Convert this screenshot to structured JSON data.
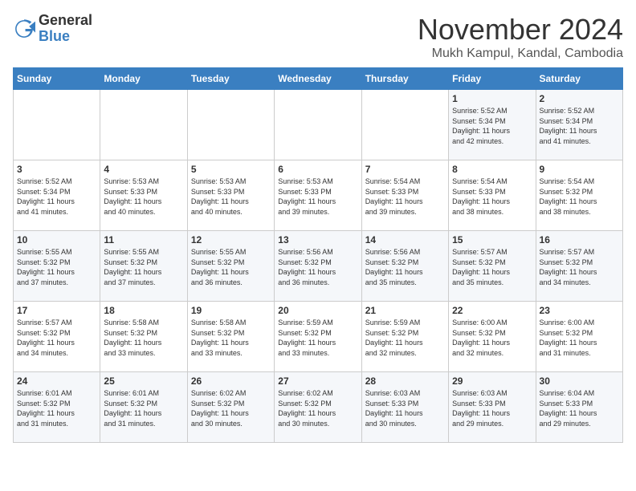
{
  "header": {
    "logo_general": "General",
    "logo_blue": "Blue",
    "month_title": "November 2024",
    "location": "Mukh Kampul, Kandal, Cambodia"
  },
  "weekdays": [
    "Sunday",
    "Monday",
    "Tuesday",
    "Wednesday",
    "Thursday",
    "Friday",
    "Saturday"
  ],
  "weeks": [
    [
      {
        "day": "",
        "info": ""
      },
      {
        "day": "",
        "info": ""
      },
      {
        "day": "",
        "info": ""
      },
      {
        "day": "",
        "info": ""
      },
      {
        "day": "",
        "info": ""
      },
      {
        "day": "1",
        "info": "Sunrise: 5:52 AM\nSunset: 5:34 PM\nDaylight: 11 hours\nand 42 minutes."
      },
      {
        "day": "2",
        "info": "Sunrise: 5:52 AM\nSunset: 5:34 PM\nDaylight: 11 hours\nand 41 minutes."
      }
    ],
    [
      {
        "day": "3",
        "info": "Sunrise: 5:52 AM\nSunset: 5:34 PM\nDaylight: 11 hours\nand 41 minutes."
      },
      {
        "day": "4",
        "info": "Sunrise: 5:53 AM\nSunset: 5:33 PM\nDaylight: 11 hours\nand 40 minutes."
      },
      {
        "day": "5",
        "info": "Sunrise: 5:53 AM\nSunset: 5:33 PM\nDaylight: 11 hours\nand 40 minutes."
      },
      {
        "day": "6",
        "info": "Sunrise: 5:53 AM\nSunset: 5:33 PM\nDaylight: 11 hours\nand 39 minutes."
      },
      {
        "day": "7",
        "info": "Sunrise: 5:54 AM\nSunset: 5:33 PM\nDaylight: 11 hours\nand 39 minutes."
      },
      {
        "day": "8",
        "info": "Sunrise: 5:54 AM\nSunset: 5:33 PM\nDaylight: 11 hours\nand 38 minutes."
      },
      {
        "day": "9",
        "info": "Sunrise: 5:54 AM\nSunset: 5:32 PM\nDaylight: 11 hours\nand 38 minutes."
      }
    ],
    [
      {
        "day": "10",
        "info": "Sunrise: 5:55 AM\nSunset: 5:32 PM\nDaylight: 11 hours\nand 37 minutes."
      },
      {
        "day": "11",
        "info": "Sunrise: 5:55 AM\nSunset: 5:32 PM\nDaylight: 11 hours\nand 37 minutes."
      },
      {
        "day": "12",
        "info": "Sunrise: 5:55 AM\nSunset: 5:32 PM\nDaylight: 11 hours\nand 36 minutes."
      },
      {
        "day": "13",
        "info": "Sunrise: 5:56 AM\nSunset: 5:32 PM\nDaylight: 11 hours\nand 36 minutes."
      },
      {
        "day": "14",
        "info": "Sunrise: 5:56 AM\nSunset: 5:32 PM\nDaylight: 11 hours\nand 35 minutes."
      },
      {
        "day": "15",
        "info": "Sunrise: 5:57 AM\nSunset: 5:32 PM\nDaylight: 11 hours\nand 35 minutes."
      },
      {
        "day": "16",
        "info": "Sunrise: 5:57 AM\nSunset: 5:32 PM\nDaylight: 11 hours\nand 34 minutes."
      }
    ],
    [
      {
        "day": "17",
        "info": "Sunrise: 5:57 AM\nSunset: 5:32 PM\nDaylight: 11 hours\nand 34 minutes."
      },
      {
        "day": "18",
        "info": "Sunrise: 5:58 AM\nSunset: 5:32 PM\nDaylight: 11 hours\nand 33 minutes."
      },
      {
        "day": "19",
        "info": "Sunrise: 5:58 AM\nSunset: 5:32 PM\nDaylight: 11 hours\nand 33 minutes."
      },
      {
        "day": "20",
        "info": "Sunrise: 5:59 AM\nSunset: 5:32 PM\nDaylight: 11 hours\nand 33 minutes."
      },
      {
        "day": "21",
        "info": "Sunrise: 5:59 AM\nSunset: 5:32 PM\nDaylight: 11 hours\nand 32 minutes."
      },
      {
        "day": "22",
        "info": "Sunrise: 6:00 AM\nSunset: 5:32 PM\nDaylight: 11 hours\nand 32 minutes."
      },
      {
        "day": "23",
        "info": "Sunrise: 6:00 AM\nSunset: 5:32 PM\nDaylight: 11 hours\nand 31 minutes."
      }
    ],
    [
      {
        "day": "24",
        "info": "Sunrise: 6:01 AM\nSunset: 5:32 PM\nDaylight: 11 hours\nand 31 minutes."
      },
      {
        "day": "25",
        "info": "Sunrise: 6:01 AM\nSunset: 5:32 PM\nDaylight: 11 hours\nand 31 minutes."
      },
      {
        "day": "26",
        "info": "Sunrise: 6:02 AM\nSunset: 5:32 PM\nDaylight: 11 hours\nand 30 minutes."
      },
      {
        "day": "27",
        "info": "Sunrise: 6:02 AM\nSunset: 5:32 PM\nDaylight: 11 hours\nand 30 minutes."
      },
      {
        "day": "28",
        "info": "Sunrise: 6:03 AM\nSunset: 5:33 PM\nDaylight: 11 hours\nand 30 minutes."
      },
      {
        "day": "29",
        "info": "Sunrise: 6:03 AM\nSunset: 5:33 PM\nDaylight: 11 hours\nand 29 minutes."
      },
      {
        "day": "30",
        "info": "Sunrise: 6:04 AM\nSunset: 5:33 PM\nDaylight: 11 hours\nand 29 minutes."
      }
    ]
  ]
}
